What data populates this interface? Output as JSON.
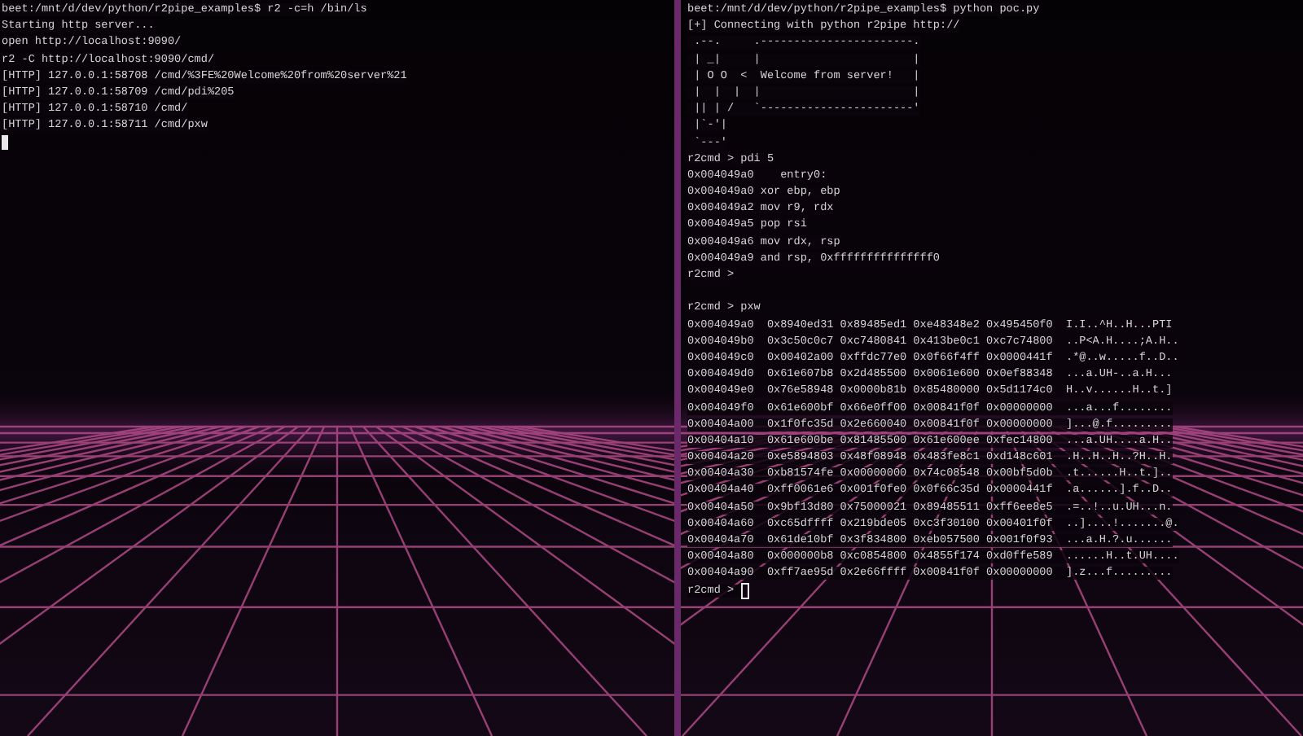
{
  "panes": [
    {
      "lines": [
        {
          "kind": "text",
          "text": "beet:/mnt/d/dev/python/r2pipe_examples$ r2 -c=h /bin/ls"
        },
        {
          "kind": "text",
          "text": "Starting http server..."
        },
        {
          "kind": "text",
          "text": "open http://localhost:9090/"
        },
        {
          "kind": "text",
          "text": "r2 -C http://localhost:9090/cmd/"
        },
        {
          "kind": "text",
          "text": "[HTTP] 127.0.0.1:58708 /cmd/%3FE%20Welcome%20from%20server%21"
        },
        {
          "kind": "text",
          "text": "[HTTP] 127.0.0.1:58709 /cmd/pdi%205"
        },
        {
          "kind": "text",
          "text": "[HTTP] 127.0.0.1:58710 /cmd/"
        },
        {
          "kind": "text",
          "text": "[HTTP] 127.0.0.1:58711 /cmd/pxw"
        },
        {
          "kind": "blank",
          "cursor": true,
          "cursor_filled": true
        }
      ]
    },
    {
      "lines": [
        {
          "kind": "text",
          "text": "beet:/mnt/d/dev/python/r2pipe_examples$ python poc.py"
        },
        {
          "kind": "text",
          "text": "[+] Connecting with python r2pipe http://"
        },
        {
          "kind": "text",
          "text": " .--.     .-----------------------."
        },
        {
          "kind": "text",
          "text": " | _|     |                       |"
        },
        {
          "kind": "text",
          "text": " | O O  <  Welcome from server!   |"
        },
        {
          "kind": "text",
          "text": " |  |  |  |                       |"
        },
        {
          "kind": "text",
          "text": " || | /   `-----------------------'"
        },
        {
          "kind": "text",
          "text": " |`-'|"
        },
        {
          "kind": "text",
          "text": " `---'"
        },
        {
          "kind": "text",
          "text": "r2cmd > pdi 5"
        },
        {
          "kind": "text",
          "text": "0x004049a0    entry0:"
        },
        {
          "kind": "text",
          "text": "0x004049a0 xor ebp, ebp"
        },
        {
          "kind": "text",
          "text": "0x004049a2 mov r9, rdx"
        },
        {
          "kind": "text",
          "text": "0x004049a5 pop rsi"
        },
        {
          "kind": "text",
          "text": "0x004049a6 mov rdx, rsp"
        },
        {
          "kind": "text",
          "text": "0x004049a9 and rsp, 0xfffffffffffffff0"
        },
        {
          "kind": "text",
          "text": "r2cmd >"
        },
        {
          "kind": "blank"
        },
        {
          "kind": "text",
          "text": "r2cmd > pxw"
        },
        {
          "kind": "text",
          "text": "0x004049a0  0x8940ed31 0x89485ed1 0xe48348e2 0x495450f0  I.I..^H..H...PTI"
        },
        {
          "kind": "text",
          "text": "0x004049b0  0x3c50c0c7 0xc7480841 0x413be0c1 0xc7c74800  ..P<A.H....;A.H.."
        },
        {
          "kind": "text",
          "text": "0x004049c0  0x00402a00 0xffdc77e0 0x0f66f4ff 0x0000441f  .*@..w.....f..D.."
        },
        {
          "kind": "text",
          "text": "0x004049d0  0x61e607b8 0x2d485500 0x0061e600 0x0ef88348  ...a.UH-..a.H..."
        },
        {
          "kind": "text",
          "text": "0x004049e0  0x76e58948 0x0000b81b 0x85480000 0x5d1174c0  H..v......H..t.]"
        },
        {
          "kind": "text",
          "text": "0x004049f0  0x61e600bf 0x66e0ff00 0x00841f0f 0x00000000  ...a...f........"
        },
        {
          "kind": "text",
          "text": "0x00404a00  0x1f0fc35d 0x2e660040 0x00841f0f 0x00000000  ]...@.f........."
        },
        {
          "kind": "text",
          "text": "0x00404a10  0x61e600be 0x81485500 0x61e600ee 0xfec14800  ...a.UH....a.H.."
        },
        {
          "kind": "text",
          "text": "0x00404a20  0xe5894803 0x48f08948 0x483fe8c1 0xd148c601  .H..H..H..?H..H."
        },
        {
          "kind": "text",
          "text": "0x00404a30  0xb81574fe 0x00000000 0x74c08548 0x00bf5d0b  .t......H..t.].."
        },
        {
          "kind": "text",
          "text": "0x00404a40  0xff0061e6 0x001f0fe0 0x0f66c35d 0x0000441f  .a......].f..D.."
        },
        {
          "kind": "text",
          "text": "0x00404a50  0x9bf13d80 0x75000021 0x89485511 0xff6ee8e5  .=..!..u.UH...n."
        },
        {
          "kind": "text",
          "text": "0x00404a60  0xc65dffff 0x219bde05 0xc3f30100 0x00401f0f  ..]....!.......@."
        },
        {
          "kind": "text",
          "text": "0x00404a70  0x61de10bf 0x3f834800 0xeb057500 0x001f0f93  ...a.H.?.u......"
        },
        {
          "kind": "text",
          "text": "0x00404a80  0x000000b8 0xc0854800 0x4855f174 0xd0ffe589  ......H..t.UH...."
        },
        {
          "kind": "text",
          "text": "0x00404a90  0xff7ae95d 0x2e66ffff 0x00841f0f 0x00000000  ].z...f........."
        },
        {
          "kind": "text",
          "text": "r2cmd > ",
          "cursor": true,
          "cursor_filled": false
        }
      ]
    }
  ]
}
